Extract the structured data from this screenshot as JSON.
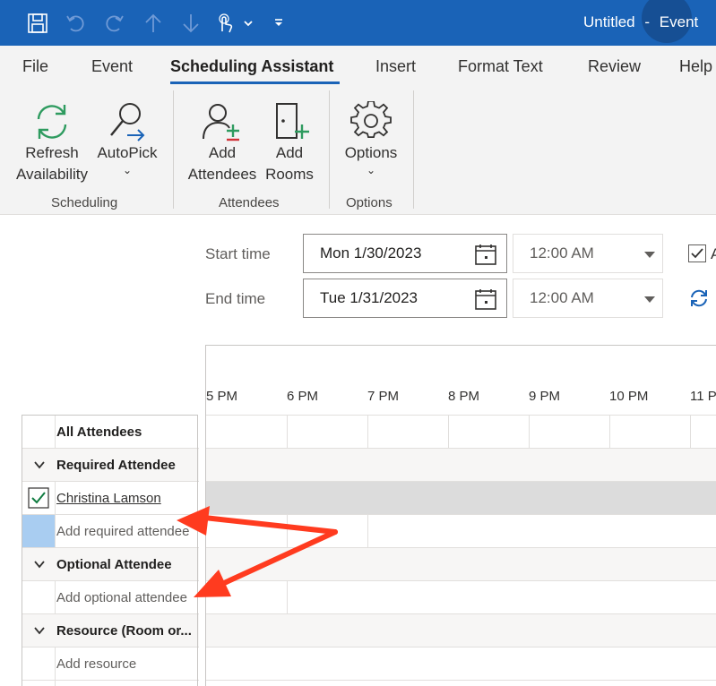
{
  "titlebar": {
    "title": "Untitled",
    "separator": "-",
    "item_type": "Event",
    "quick_access": [
      "save-icon",
      "undo-icon",
      "redo-icon",
      "up-arrow-icon",
      "down-arrow-icon",
      "touch-mode-icon",
      "chevron-down-icon",
      "customize-toolbar-icon"
    ]
  },
  "tabs": {
    "file": "File",
    "event": "Event",
    "scheduling_assistant": "Scheduling Assistant",
    "insert": "Insert",
    "format_text": "Format Text",
    "review": "Review",
    "help": "Help"
  },
  "ribbon": {
    "scheduling": {
      "label": "Scheduling",
      "refresh_line1": "Refresh",
      "refresh_line2": "Availability",
      "autopick": "AutoPick",
      "autopick_caret": "⌄"
    },
    "attendees": {
      "label": "Attendees",
      "add_attendees_line1": "Add",
      "add_attendees_line2": "Attendees",
      "add_rooms_line1": "Add",
      "add_rooms_line2": "Rooms"
    },
    "options": {
      "label": "Options",
      "options_button": "Options",
      "options_caret": "⌄"
    }
  },
  "times": {
    "start_label": "Start time",
    "start_date": "Mon 1/30/2023",
    "start_time": "12:00 AM",
    "end_label": "End time",
    "end_date": "Tue 1/31/2023",
    "end_time": "12:00 AM",
    "allday_partial": "A",
    "allday_checked": true
  },
  "grid": {
    "hours": [
      "5 PM",
      "6 PM",
      "7 PM",
      "8 PM",
      "9 PM",
      "10 PM",
      "11 P"
    ],
    "busy_color": "#dcdcdc"
  },
  "attendees": {
    "header": "All Attendees",
    "required_section": "Required Attendee",
    "required_name": "Christina Lamson",
    "add_required_placeholder": "Add required attendee",
    "optional_section": "Optional Attendee",
    "add_optional_placeholder": "Add optional attendee",
    "resource_section": "Resource (Room or...",
    "add_resource_placeholder": "Add resource"
  },
  "colors": {
    "accent": "#1a63b7",
    "annotation": "#ff3b1f",
    "selection": "#a9cdf1",
    "check": "#107c41"
  }
}
